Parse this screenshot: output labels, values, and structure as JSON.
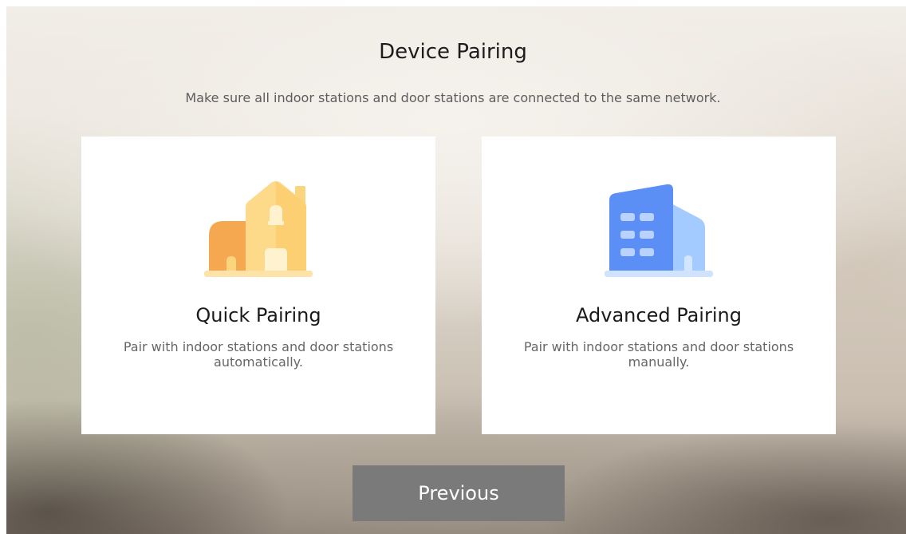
{
  "header": {
    "title": "Device Pairing",
    "subtitle": "Make sure all indoor stations and door stations are connected to the same network."
  },
  "cards": [
    {
      "title": "Quick Pairing",
      "description": "Pair with indoor stations and door stations automatically.",
      "icon": "house-icon"
    },
    {
      "title": "Advanced Pairing",
      "description": "Pair with indoor stations and door stations manually.",
      "icon": "building-icon"
    }
  ],
  "footer": {
    "previous_label": "Previous"
  },
  "colors": {
    "card_background": "#ffffff",
    "button_background": "#7a7a7a",
    "house_orange": "#f5a84f",
    "house_yellow": "#fbd57e",
    "building_blue": "#5b8ff6",
    "building_light_blue": "#a3cbff"
  }
}
